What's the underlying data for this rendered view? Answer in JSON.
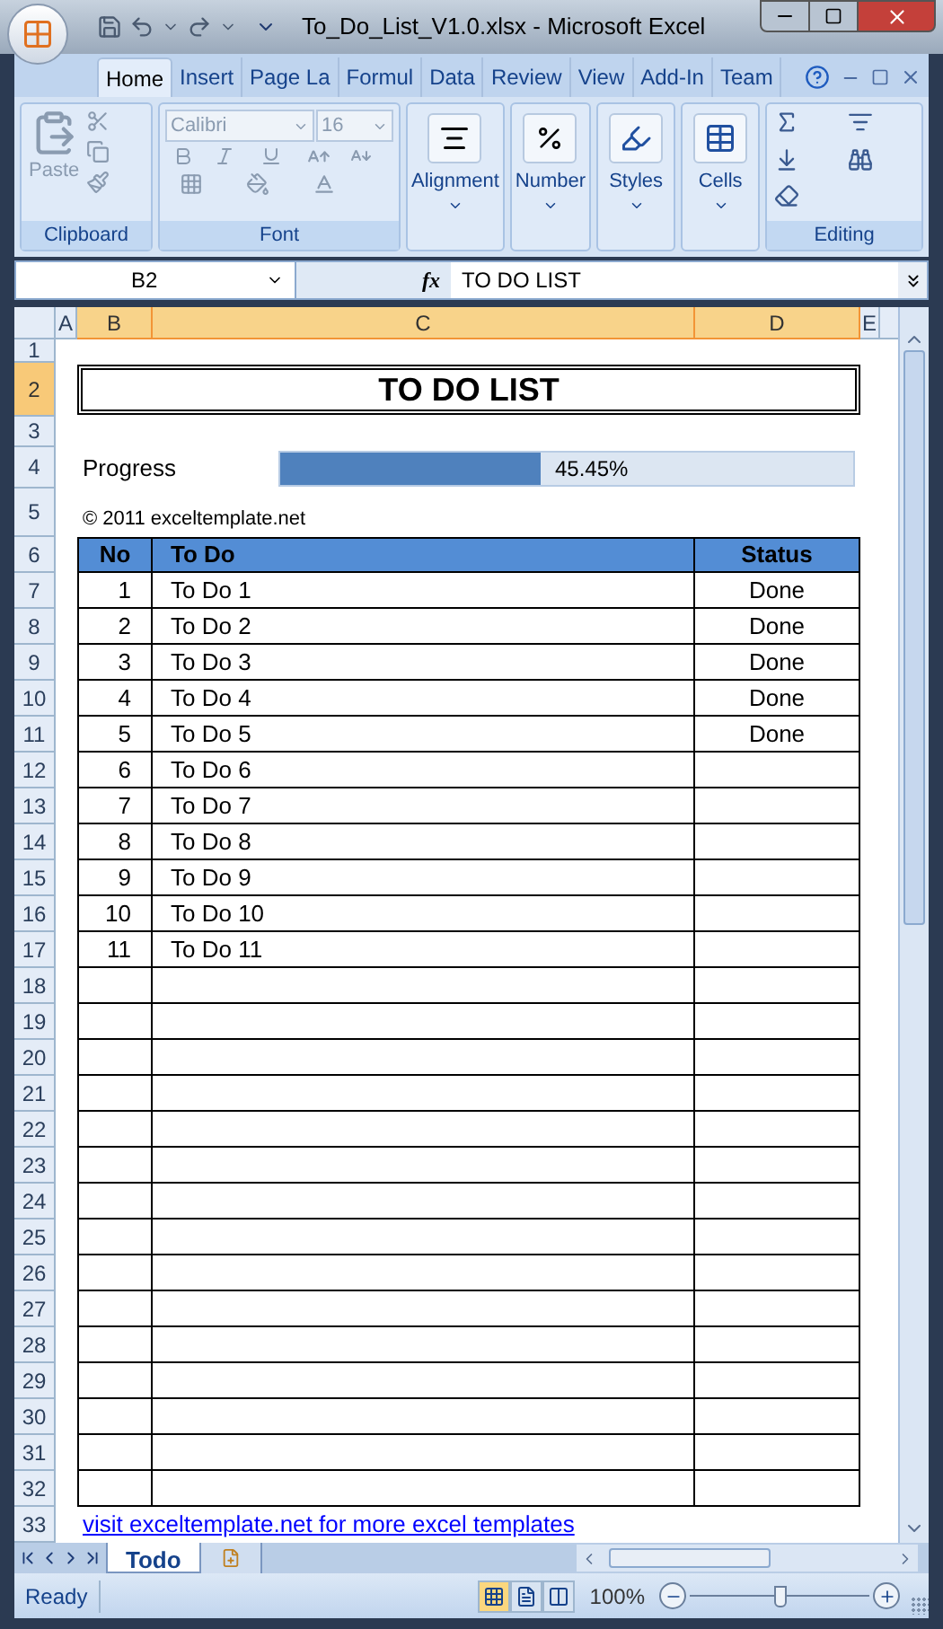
{
  "window": {
    "title": "To_Do_List_V1.0.xlsx - Microsoft Excel"
  },
  "ribbon_tabs": [
    {
      "label": "Home",
      "selected": true
    },
    {
      "label": "Insert",
      "selected": false
    },
    {
      "label": "Page La",
      "selected": false
    },
    {
      "label": "Formul",
      "selected": false
    },
    {
      "label": "Data",
      "selected": false
    },
    {
      "label": "Review",
      "selected": false
    },
    {
      "label": "View",
      "selected": false
    },
    {
      "label": "Add-In",
      "selected": false
    },
    {
      "label": "Team",
      "selected": false
    }
  ],
  "ribbon": {
    "clipboard": {
      "label": "Clipboard",
      "paste": "Paste",
      "disabled": true
    },
    "font": {
      "label": "Font",
      "font_name": "Calibri",
      "font_size": "16",
      "disabled": true
    },
    "collapsed_groups": [
      {
        "label": "Alignment",
        "kind": "alignment"
      },
      {
        "label": "Number",
        "kind": "number"
      },
      {
        "label": "Styles",
        "kind": "styles"
      },
      {
        "label": "Cells",
        "kind": "cells"
      }
    ],
    "editing": {
      "label": "Editing"
    }
  },
  "formula_bar": {
    "name_box": "B2",
    "function_icon": "fx",
    "formula": "TO DO LIST"
  },
  "columns": [
    {
      "label": "A",
      "selected": false
    },
    {
      "label": "B",
      "selected": true
    },
    {
      "label": "C",
      "selected": true
    },
    {
      "label": "D",
      "selected": true
    },
    {
      "label": "E",
      "selected": false
    }
  ],
  "row_headers": [
    {
      "label": "1",
      "selected": false
    },
    {
      "label": "2",
      "selected": true
    },
    {
      "label": "3",
      "selected": false
    },
    {
      "label": "4",
      "selected": false
    },
    {
      "label": "5",
      "selected": false
    },
    {
      "label": "6",
      "selected": false
    },
    {
      "label": "7",
      "selected": false
    },
    {
      "label": "8",
      "selected": false
    },
    {
      "label": "9",
      "selected": false
    },
    {
      "label": "10",
      "selected": false
    },
    {
      "label": "11",
      "selected": false
    },
    {
      "label": "12",
      "selected": false
    },
    {
      "label": "13",
      "selected": false
    },
    {
      "label": "14",
      "selected": false
    },
    {
      "label": "15",
      "selected": false
    },
    {
      "label": "16",
      "selected": false
    },
    {
      "label": "17",
      "selected": false
    },
    {
      "label": "18",
      "selected": false
    },
    {
      "label": "19",
      "selected": false
    },
    {
      "label": "20",
      "selected": false
    },
    {
      "label": "21",
      "selected": false
    },
    {
      "label": "22",
      "selected": false
    },
    {
      "label": "23",
      "selected": false
    },
    {
      "label": "24",
      "selected": false
    },
    {
      "label": "25",
      "selected": false
    },
    {
      "label": "26",
      "selected": false
    },
    {
      "label": "27",
      "selected": false
    },
    {
      "label": "28",
      "selected": false
    },
    {
      "label": "29",
      "selected": false
    },
    {
      "label": "30",
      "selected": false
    },
    {
      "label": "31",
      "selected": false
    },
    {
      "label": "32",
      "selected": false
    },
    {
      "label": "33",
      "selected": false
    }
  ],
  "sheet": {
    "title": "TO DO LIST",
    "progress": {
      "label": "Progress",
      "level": 0.4545,
      "reading": "45.45%"
    },
    "copyright": "© 2011 exceltemplate.net",
    "table": {
      "columns": [
        "No",
        "To Do",
        "Status"
      ],
      "rows": [
        {
          "no": "1",
          "task": "To Do 1",
          "status": "Done"
        },
        {
          "no": "2",
          "task": "To Do 2",
          "status": "Done"
        },
        {
          "no": "3",
          "task": "To Do 3",
          "status": "Done"
        },
        {
          "no": "4",
          "task": "To Do 4",
          "status": "Done"
        },
        {
          "no": "5",
          "task": "To Do 5",
          "status": "Done"
        },
        {
          "no": "6",
          "task": "To Do 6"
        },
        {
          "no": "7",
          "task": "To Do 7"
        },
        {
          "no": "8",
          "task": "To Do 8"
        },
        {
          "no": "9",
          "task": "To Do 9"
        },
        {
          "no": "10",
          "task": "To Do 10"
        },
        {
          "no": "11",
          "task": "To Do 11"
        }
      ]
    },
    "link": "visit exceltemplate.net for more excel templates"
  },
  "sheet_tabs": [
    {
      "label": "Todo",
      "selected": true
    }
  ],
  "status_bar": {
    "status": "Ready",
    "views": [
      {
        "kind": "normal",
        "selected": true
      },
      {
        "kind": "page_layout",
        "selected": false
      },
      {
        "kind": "page_break",
        "selected": false
      }
    ],
    "zoom": "100%",
    "zoom_slider": {
      "level": 0.5
    }
  }
}
